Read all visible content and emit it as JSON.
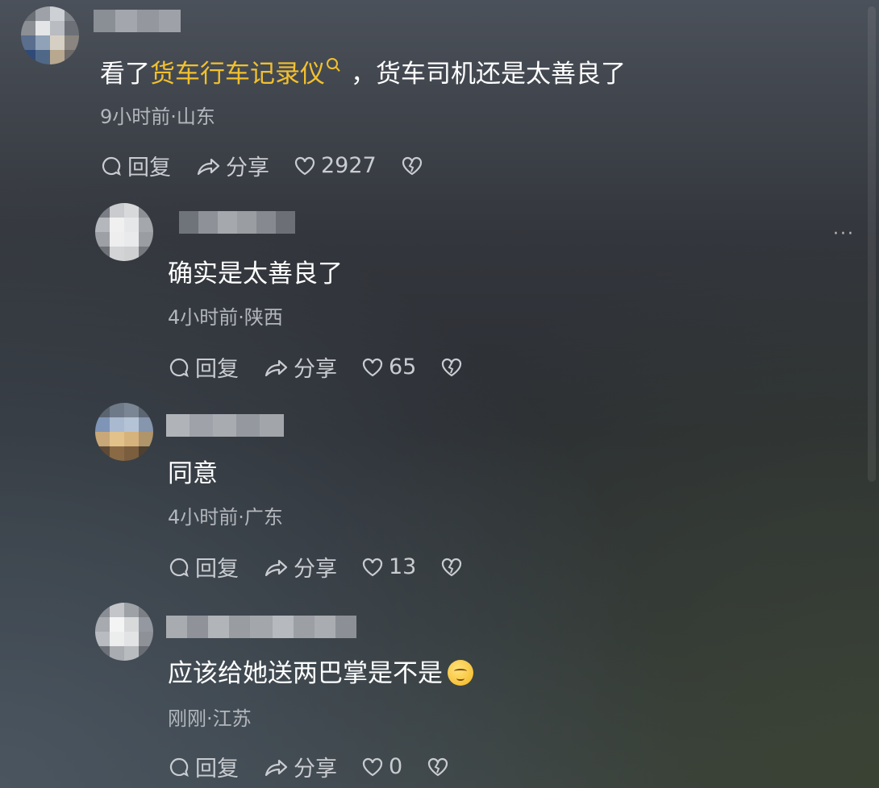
{
  "comments": [
    {
      "text_before": "看了",
      "highlight": "货车行车记录仪",
      "text_after": "，货车司机还是太善良了",
      "emoji": null,
      "meta": "9小时前·山东",
      "reply": "回复",
      "share": "分享",
      "likes": "2927"
    },
    {
      "text_before": "确实是太善良了",
      "highlight": "",
      "text_after": "",
      "emoji": null,
      "meta": "4小时前·陕西",
      "reply": "回复",
      "share": "分享",
      "likes": "65"
    },
    {
      "text_before": "同意",
      "highlight": "",
      "text_after": "",
      "emoji": null,
      "meta": "4小时前·广东",
      "reply": "回复",
      "share": "分享",
      "likes": "13"
    },
    {
      "text_before": "应该给她送两巴掌是不是",
      "highlight": "",
      "text_after": "",
      "emoji": "smirk-emoji",
      "meta": "刚刚·江苏",
      "reply": "回复",
      "share": "分享",
      "likes": "0"
    }
  ],
  "more_menu": "···",
  "colors": {
    "highlight": "#f2c02e",
    "meta": "#b3b7bd",
    "action": "#c9ccd1"
  },
  "icons": [
    "comment-bubble-icon",
    "share-arrow-icon",
    "heart-icon",
    "broken-heart-icon",
    "search-icon"
  ]
}
